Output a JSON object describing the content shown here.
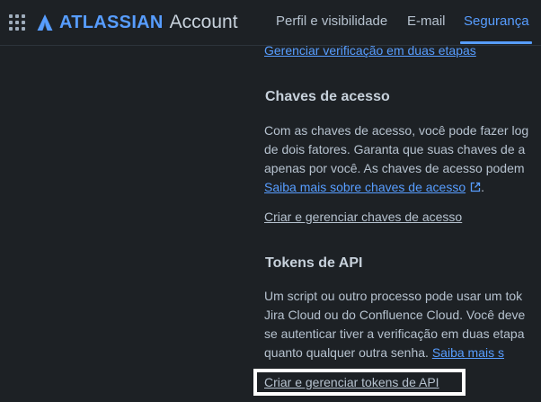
{
  "header": {
    "brand": "ATLASSIAN",
    "product": "Account",
    "tabs": [
      {
        "label": "Perfil e visibilidade"
      },
      {
        "label": "E-mail"
      },
      {
        "label": "Segurança"
      }
    ]
  },
  "security": {
    "two_step_link": "Gerenciar verificação em duas etapas",
    "passkeys": {
      "title": "Chaves de acesso",
      "lines": [
        "Com as chaves de acesso, você pode fazer log",
        "de dois fatores. Garanta que suas chaves de a",
        "apenas por você. As chaves de acesso podem"
      ],
      "learn_more": "Saiba mais sobre chaves de acesso",
      "learn_more_suffix": ".",
      "manage_link": "Criar e gerenciar chaves de acesso"
    },
    "api_tokens": {
      "title": "Tokens de API",
      "lines": [
        "Um script ou outro processo pode usar um tok",
        "Jira Cloud ou do Confluence Cloud. Você deve",
        "se autenticar tiver a verificação em duas etapa"
      ],
      "last_line": "quanto qualquer outra senha.",
      "learn_more": "Saiba mais s",
      "manage_link": "Criar e gerenciar tokens de API"
    }
  },
  "colors": {
    "background": "#1d2125",
    "link": "#579dff",
    "text": "#b6c2cf",
    "heading": "#c7d1db",
    "highlight": "#ffffff"
  }
}
